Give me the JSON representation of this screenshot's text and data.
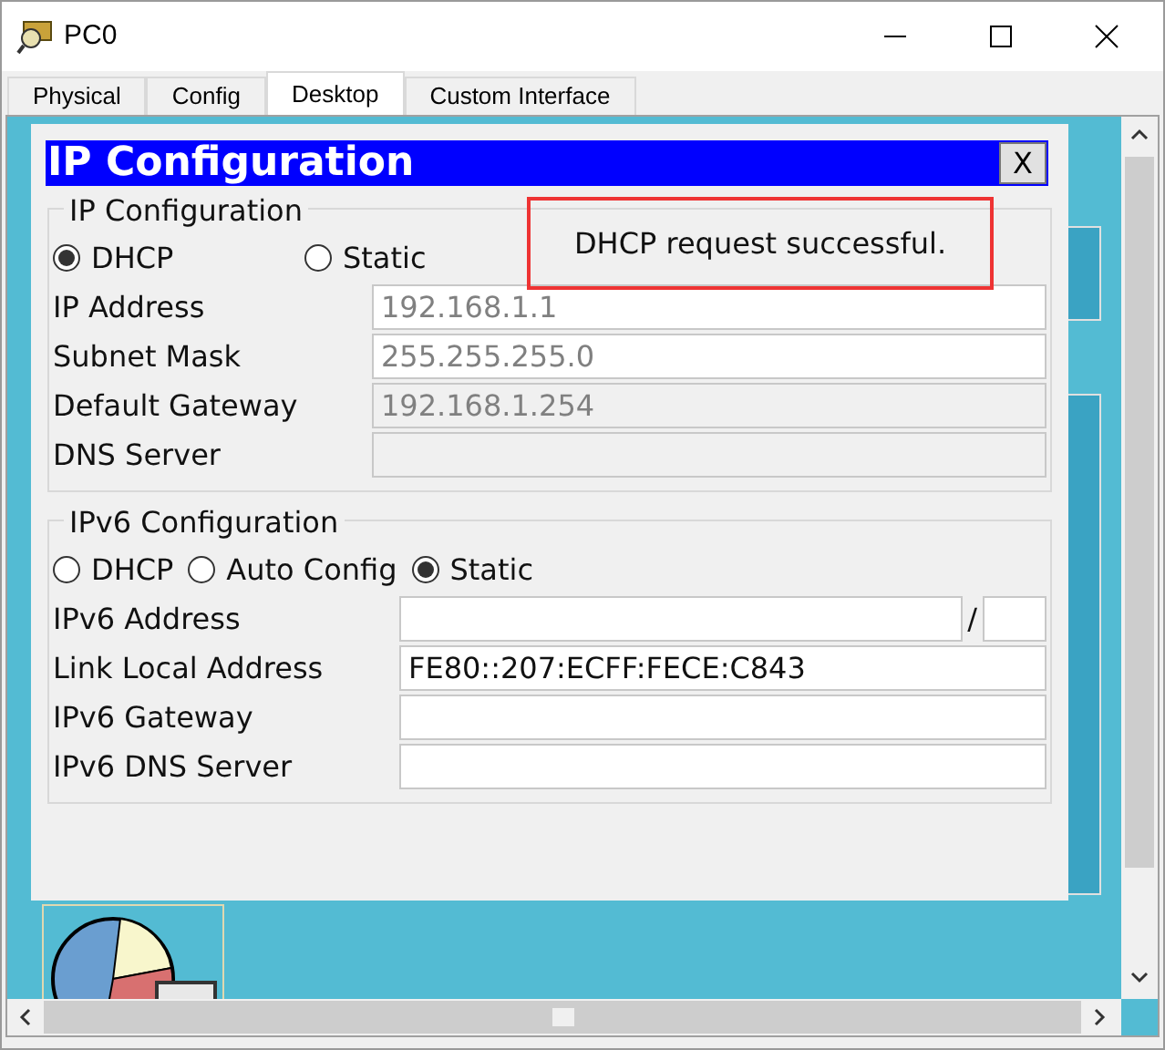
{
  "window": {
    "title": "PC0"
  },
  "tabs": [
    {
      "label": "Physical",
      "selected": false
    },
    {
      "label": "Config",
      "selected": false
    },
    {
      "label": "Desktop",
      "selected": true
    },
    {
      "label": "Custom Interface",
      "selected": false
    }
  ],
  "dialog": {
    "title": "IP Configuration",
    "close": "X",
    "ipv4": {
      "legend": "IP Configuration",
      "message": "DHCP request successful.",
      "modes": [
        {
          "label": "DHCP",
          "selected": true
        },
        {
          "label": "Static",
          "selected": false
        }
      ],
      "fields": [
        {
          "kind": "text",
          "label": "IP Address",
          "value": "192.168.1.1",
          "disabled": false
        },
        {
          "kind": "text",
          "label": "Subnet Mask",
          "value": "255.255.255.0",
          "disabled": false
        },
        {
          "kind": "text",
          "label": "Default Gateway",
          "value": "192.168.1.254",
          "disabled": true
        },
        {
          "kind": "text",
          "label": "DNS Server",
          "disabled": true
        }
      ]
    },
    "ipv6": {
      "legend": "IPv6 Configuration",
      "modes": [
        {
          "label": "DHCP",
          "selected": false
        },
        {
          "label": "Auto Config",
          "selected": false
        },
        {
          "label": "Static",
          "selected": true
        }
      ],
      "fields": [
        {
          "kind": "prefixed",
          "label": "IPv6 Address",
          "separator": "/",
          "disabled": false
        },
        {
          "kind": "text",
          "label": "Link Local Address",
          "value": "FE80::207:ECFF:FECE:C843",
          "disabled": false
        },
        {
          "kind": "text",
          "label": "IPv6 Gateway",
          "disabled": false
        },
        {
          "kind": "text",
          "label": "IPv6 DNS Server",
          "disabled": false
        }
      ]
    }
  }
}
